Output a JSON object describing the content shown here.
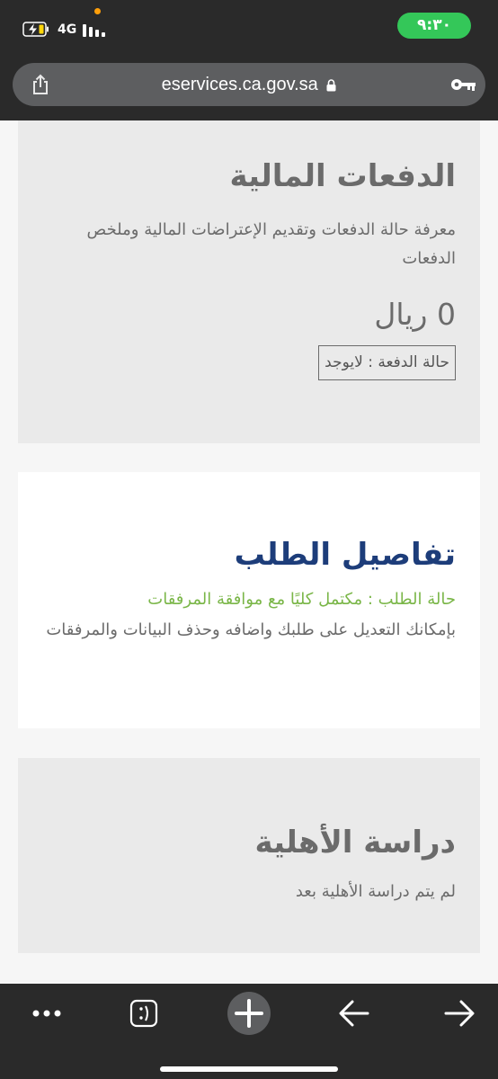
{
  "status_bar": {
    "network": "4G",
    "time": "٩:٣٠",
    "time_badge_color": "#34c759"
  },
  "browser": {
    "url": "eservices.ca.gov.sa",
    "icons": [
      "share-icon",
      "lock-icon",
      "key-icon"
    ]
  },
  "payments": {
    "title": "الدفعات المالية",
    "description": "معرفة حالة الدفعات وتقديم الإعتراضات المالية وملخص الدفعات",
    "amount": "0 ريال",
    "status": "حالة الدفعة : لايوجد"
  },
  "request_details": {
    "title": "تفاصيل الطلب",
    "status": "حالة الطلب : مكتمل كليًا مع موافقة المرفقات",
    "description": "بإمكانك التعديل على طلبك واضافه وحذف البيانات والمرفقات",
    "title_color": "#1d3d7a",
    "status_color": "#7ab648"
  },
  "eligibility": {
    "title": "دراسة الأهلية",
    "description": "لم يتم دراسة الأهلية بعد"
  },
  "toolbar": {
    "icons": [
      "more-icon",
      "tabs-icon",
      "new-tab-icon",
      "back-icon",
      "forward-icon"
    ]
  }
}
